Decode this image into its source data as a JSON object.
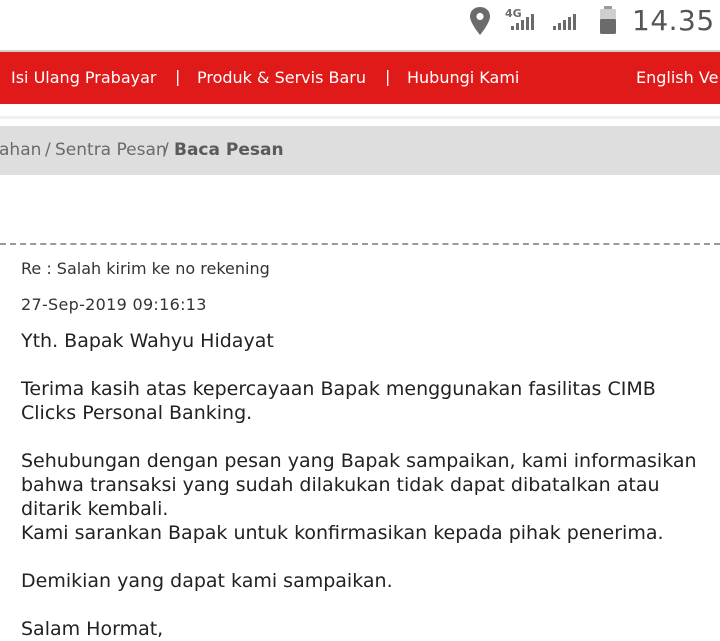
{
  "status": {
    "time": "14.35",
    "network_label": "4G"
  },
  "nav": {
    "items": [
      "Isi Ulang Prabayar",
      "Produk & Servis Baru",
      "Hubungi Kami"
    ],
    "separator": "|",
    "language": "English Ve"
  },
  "breadcrumb": {
    "partial": "ahan",
    "sep": "/",
    "middle": "Sentra Pesan",
    "current": "Baca Pesan"
  },
  "message": {
    "subject": "Re : Salah kirim ke no rekening",
    "date": "27-Sep-2019 09:16:13",
    "salutation": "Yth. Bapak Wahyu Hidayat",
    "para1": "Terima kasih atas kepercayaan Bapak menggunakan fasilitas CIMB Clicks Personal Banking.",
    "para2": "Sehubungan dengan pesan yang Bapak sampaikan, kami informasikan bahwa transaksi yang sudah dilakukan tidak dapat dibatalkan atau ditarik kembali.",
    "para3": "Kami sarankan Bapak untuk konfirmasikan kepada pihak penerima.",
    "para4": "Demikian yang dapat kami sampaikan.",
    "closing": "Salam Hormat,"
  },
  "colors": {
    "nav_red": "#e01919",
    "breadcrumb_bg": "#dedede"
  }
}
